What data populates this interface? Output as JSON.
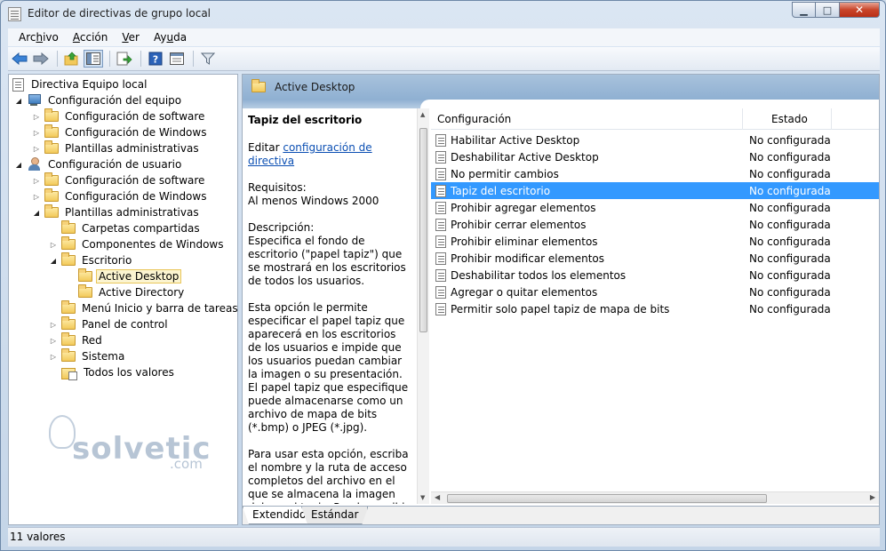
{
  "window": {
    "title": "Editor de directivas de grupo local",
    "caption": {
      "minimize": "▁",
      "maximize": "□",
      "close": "✕"
    }
  },
  "menu": [
    {
      "pre": "Arc",
      "u": "h",
      "post": "ivo"
    },
    {
      "pre": "",
      "u": "A",
      "post": "cción"
    },
    {
      "pre": "",
      "u": "V",
      "post": "er"
    },
    {
      "pre": "Ay",
      "u": "u",
      "post": "da"
    }
  ],
  "toolbar": {
    "icons": [
      "back-icon",
      "forward-icon",
      "up-folder-icon",
      "show-hide-tree-icon",
      "export-list-icon",
      "help-icon",
      "properties-icon",
      "filter-icon"
    ]
  },
  "tree": [
    {
      "label": "Directiva Equipo local",
      "level": 0,
      "arrow": "",
      "icon": "policy"
    },
    {
      "label": "Configuración del equipo",
      "level": 1,
      "arrow": "open",
      "icon": "computer"
    },
    {
      "label": "Configuración de software",
      "level": 2,
      "arrow": "closed",
      "icon": "folder"
    },
    {
      "label": "Configuración de Windows",
      "level": 2,
      "arrow": "closed",
      "icon": "folder"
    },
    {
      "label": "Plantillas administrativas",
      "level": 2,
      "arrow": "closed",
      "icon": "folder"
    },
    {
      "label": "Configuración de usuario",
      "level": 1,
      "arrow": "open",
      "icon": "user"
    },
    {
      "label": "Configuración de software",
      "level": 2,
      "arrow": "closed",
      "icon": "folder"
    },
    {
      "label": "Configuración de Windows",
      "level": 2,
      "arrow": "closed",
      "icon": "folder"
    },
    {
      "label": "Plantillas administrativas",
      "level": 2,
      "arrow": "open",
      "icon": "folder"
    },
    {
      "label": "Carpetas compartidas",
      "level": 3,
      "arrow": "",
      "icon": "folder"
    },
    {
      "label": "Componentes de Windows",
      "level": 3,
      "arrow": "closed",
      "icon": "folder"
    },
    {
      "label": "Escritorio",
      "level": 3,
      "arrow": "open",
      "icon": "folder"
    },
    {
      "label": "Active Desktop",
      "level": 4,
      "arrow": "",
      "icon": "folder",
      "selected": true
    },
    {
      "label": "Active Directory",
      "level": 4,
      "arrow": "",
      "icon": "folder"
    },
    {
      "label": "Menú Inicio y barra de tareas",
      "level": 3,
      "arrow": "",
      "icon": "folder"
    },
    {
      "label": "Panel de control",
      "level": 3,
      "arrow": "closed",
      "icon": "folder"
    },
    {
      "label": "Red",
      "level": 3,
      "arrow": "closed",
      "icon": "folder"
    },
    {
      "label": "Sistema",
      "level": 3,
      "arrow": "closed",
      "icon": "folder"
    },
    {
      "label": "Todos los valores",
      "level": 3,
      "arrow": "",
      "icon": "allvalues"
    }
  ],
  "right_header": {
    "title": "Active Desktop"
  },
  "description": {
    "title": "Tapiz del escritorio",
    "edit_prefix": "Editar ",
    "edit_link": "configuración de directiva",
    "requirements_label": "Requisitos:",
    "requirements_value": "Al menos Windows 2000",
    "description_label": "Descripción:",
    "description_text": "Especifica el fondo de escritorio (\"papel tapiz\") que se mostrará en los escritorios de todos los usuarios.",
    "paragraph_2": "Esta opción le permite especificar el papel tapiz que aparecerá en los escritorios de los usuarios e impide que los usuarios puedan cambiar la imagen o su presentación. El papel tapiz que especifique puede almacenarse como un archivo de mapa de bits (*.bmp) o JPEG (*.jpg).",
    "paragraph_3": "Para usar esta opción, escriba el nombre y la ruta de acceso completos del archivo en el que se almacena la imagen del papel tapiz. Puede escribir una ruta de acceso local, como"
  },
  "list": {
    "columns": {
      "config": "Configuración",
      "estado": "Estado"
    },
    "rows": [
      {
        "name": "Habilitar Active Desktop",
        "state": "No configurada"
      },
      {
        "name": "Deshabilitar Active Desktop",
        "state": "No configurada"
      },
      {
        "name": "No permitir cambios",
        "state": "No configurada"
      },
      {
        "name": "Tapiz del escritorio",
        "state": "No configurada",
        "selected": true
      },
      {
        "name": "Prohibir agregar elementos",
        "state": "No configurada"
      },
      {
        "name": "Prohibir cerrar elementos",
        "state": "No configurada"
      },
      {
        "name": "Prohibir eliminar elementos",
        "state": "No configurada"
      },
      {
        "name": "Prohibir modificar elementos",
        "state": "No configurada"
      },
      {
        "name": "Deshabilitar todos los elementos",
        "state": "No configurada"
      },
      {
        "name": "Agregar o quitar elementos",
        "state": "No configurada"
      },
      {
        "name": "Permitir solo papel tapiz de mapa de bits",
        "state": "No configurada"
      }
    ]
  },
  "tabs": [
    {
      "label": "Extendido",
      "active": true
    },
    {
      "label": "Estándar",
      "active": false
    }
  ],
  "status": {
    "text": "11 valores"
  },
  "watermark": {
    "text": "solvetic",
    "suffix": ".com"
  }
}
